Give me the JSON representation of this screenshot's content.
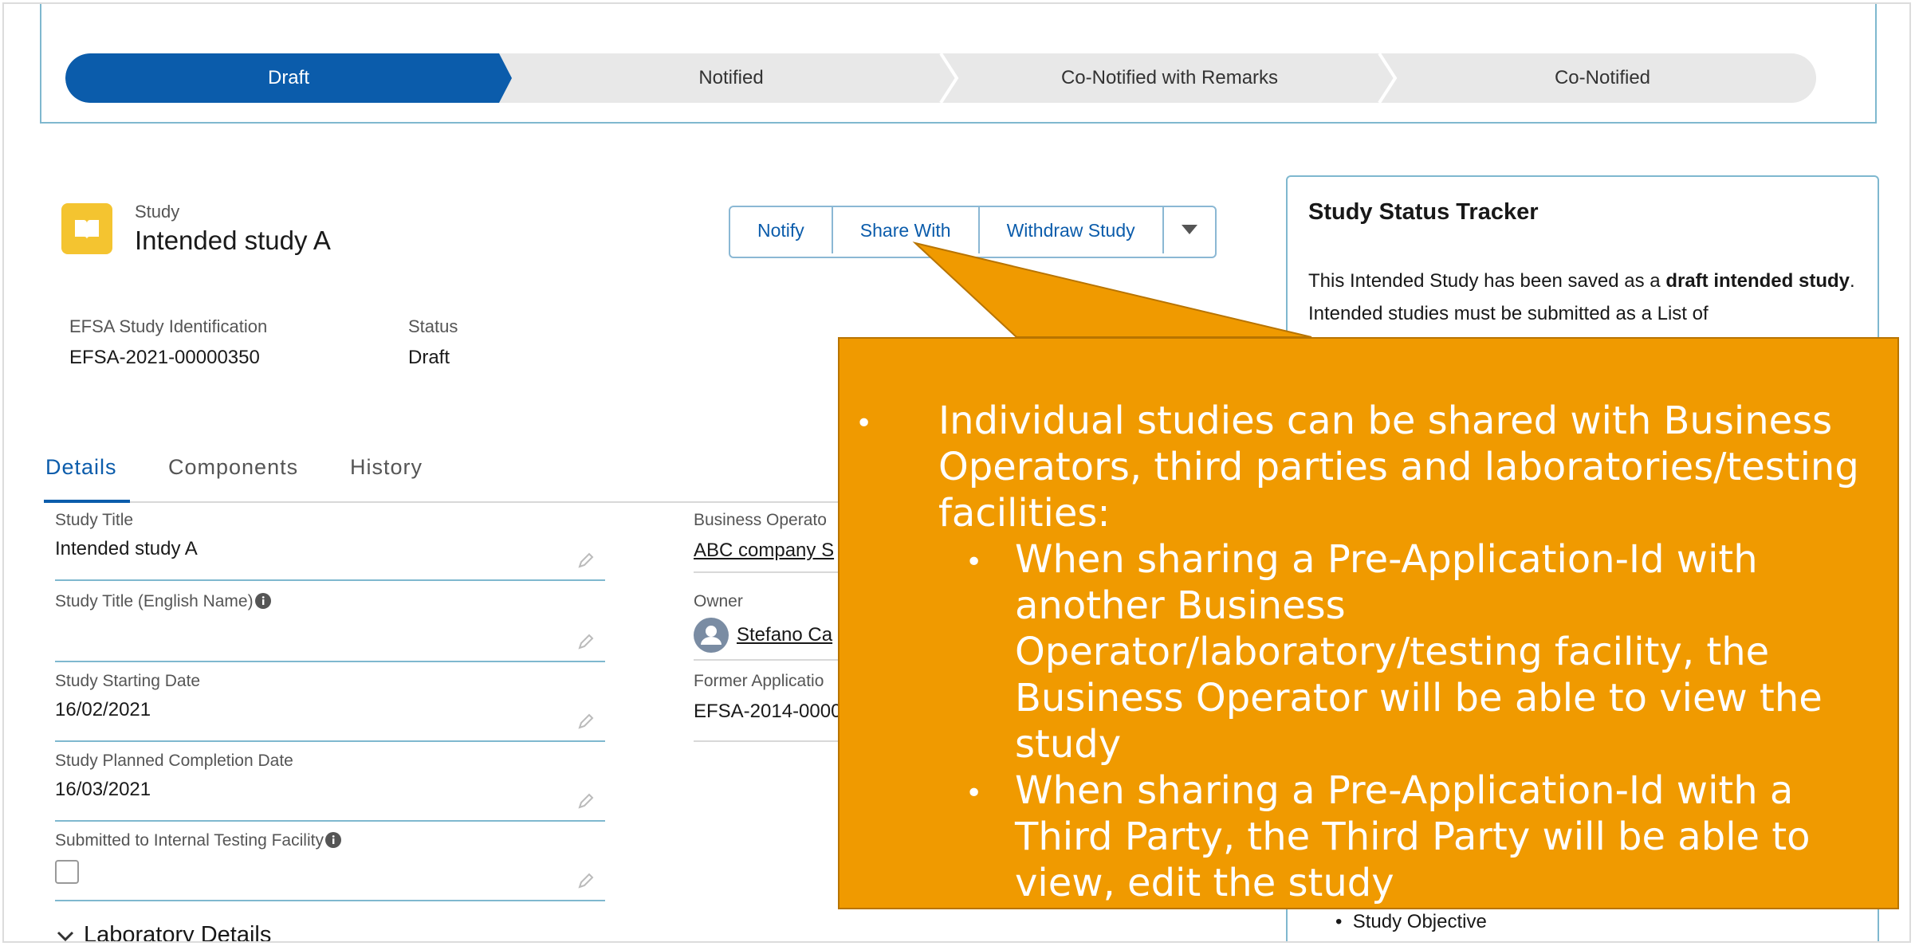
{
  "path": {
    "stages": [
      "Draft",
      "Notified",
      "Co-Notified with Remarks",
      "Co-Notified"
    ],
    "active_index": 0
  },
  "record": {
    "type": "Study",
    "name": "Intended study A",
    "icon": "book-icon"
  },
  "actions": {
    "notify": "Notify",
    "share_with": "Share With",
    "withdraw": "Withdraw Study",
    "more": "chevron-down-icon"
  },
  "highlights": {
    "efsa_label": "EFSA Study Identification",
    "efsa_value": "EFSA-2021-00000350",
    "status_label": "Status",
    "status_value": "Draft"
  },
  "tabs": [
    "Details",
    "Components",
    "History"
  ],
  "details": {
    "study_title_label": "Study Title",
    "study_title_value": "Intended study A",
    "english_name_label": "Study Title (English Name)",
    "english_name_value": "",
    "start_date_label": "Study Starting Date",
    "start_date_value": "16/02/2021",
    "completion_label": "Study Planned Completion Date",
    "completion_value": "16/03/2021",
    "submitted_label": "Submitted to Internal Testing Facility",
    "business_operator_label": "Business Operato",
    "business_operator_value": "ABC company S",
    "owner_label": "Owner",
    "owner_value": "Stefano Ca",
    "former_app_label": "Former Applicatio",
    "former_app_value": "EFSA-2014-0000"
  },
  "section": {
    "laboratory_details": "Laboratory Details"
  },
  "tracker": {
    "title": "Study Status Tracker",
    "text_before": "This Intended Study has been saved as a ",
    "text_bold": "draft intended study",
    "text_after": ". Intended studies must be submitted as a List of",
    "list_item": "Study Objective"
  },
  "callout": {
    "main": "Individual studies can be shared with Business Operators, third parties and laboratories/testing facilities:",
    "sub1": "When sharing a Pre-Application-Id with another Business Operator/laboratory/testing facility, the Business Operator will be able to view the study",
    "sub2": "When sharing a Pre-Application-Id with a Third Party, the Third Party will be able to view, edit the study"
  },
  "colors": {
    "brand_blue": "#0b5cab",
    "callout_orange": "#f09a00",
    "record_icon_yellow": "#f4c430"
  }
}
